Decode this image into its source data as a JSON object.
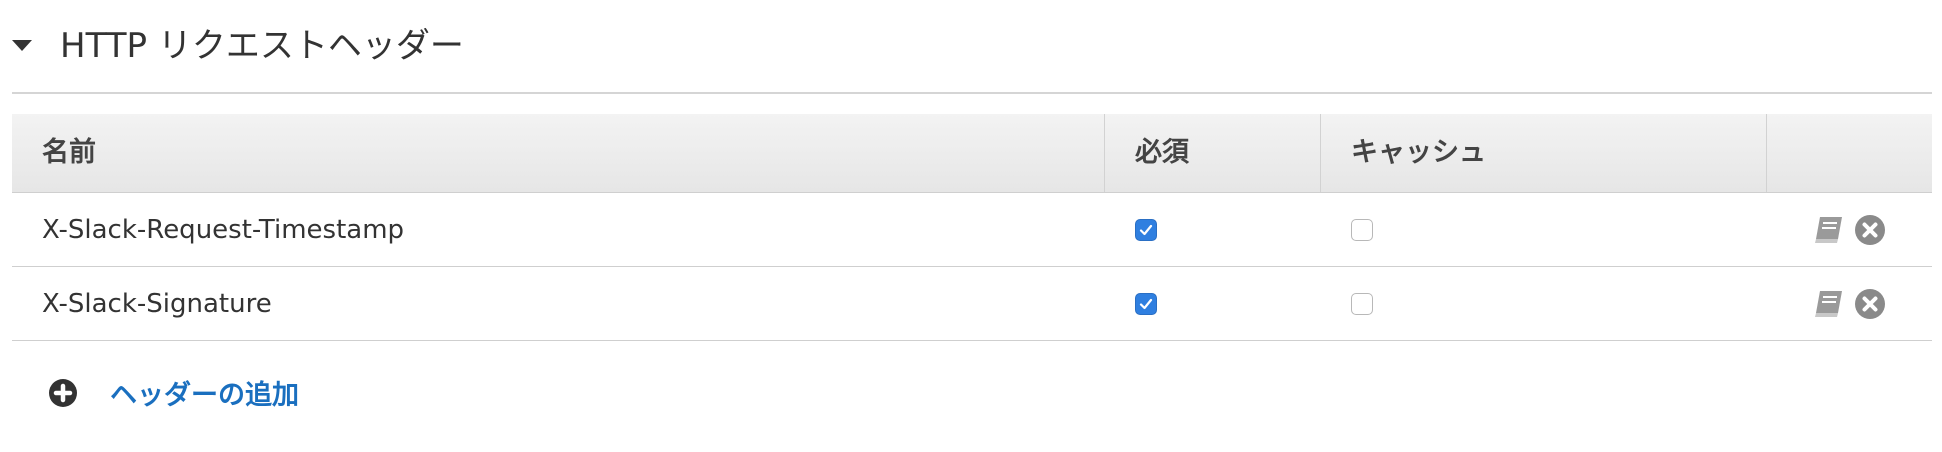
{
  "section": {
    "title": "HTTP リクエストヘッダー"
  },
  "table": {
    "columns": {
      "name": "名前",
      "required": "必須",
      "cache": "キャッシュ",
      "actions": ""
    },
    "rows": [
      {
        "name": "X-Slack-Request-Timestamp",
        "required": true,
        "cache": false
      },
      {
        "name": "X-Slack-Signature",
        "required": true,
        "cache": false
      }
    ]
  },
  "add_header": {
    "label": "ヘッダーの追加"
  },
  "colors": {
    "accent": "#2f7fe0",
    "link": "#1a6fbf",
    "icon_gray": "#8a8a8a"
  },
  "icons": [
    "caret-down-icon",
    "edit-book-icon",
    "remove-circle-icon",
    "plus-circle-icon",
    "checkmark-icon"
  ]
}
